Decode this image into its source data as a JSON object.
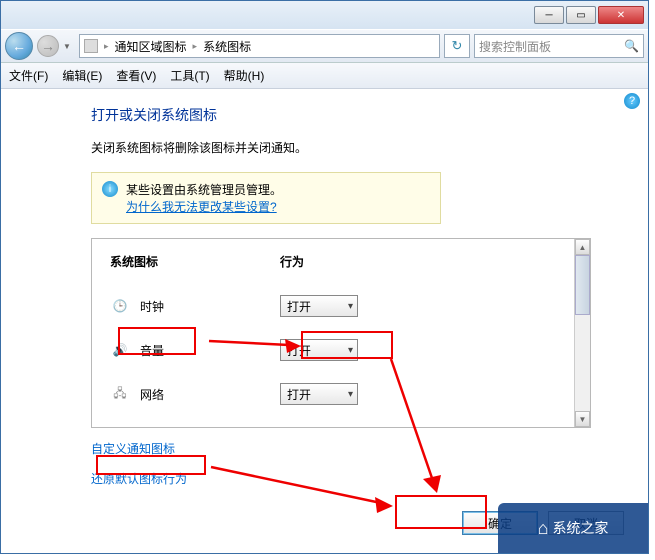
{
  "breadcrumb": {
    "item1": "通知区域图标",
    "item2": "系统图标"
  },
  "search_placeholder": "搜索控制面板",
  "menu": {
    "file": "文件(F)",
    "edit": "编辑(E)",
    "view": "查看(V)",
    "tools": "工具(T)",
    "help": "帮助(H)"
  },
  "title": "打开或关闭系统图标",
  "desc": "关闭系统图标将删除该图标并关闭通知。",
  "warn": {
    "line1": "某些设置由系统管理员管理。",
    "link": "为什么我无法更改某些设置?"
  },
  "headers": {
    "icon": "系统图标",
    "behavior": "行为"
  },
  "rows": [
    {
      "label": "时钟",
      "value": "打开"
    },
    {
      "label": "音量",
      "value": "打开"
    },
    {
      "label": "网络",
      "value": "打开"
    }
  ],
  "link_custom": "自定义通知图标",
  "link_restore": "还原默认图标行为",
  "ok": "确定",
  "cancel": "取消",
  "watermark": "系统之家"
}
